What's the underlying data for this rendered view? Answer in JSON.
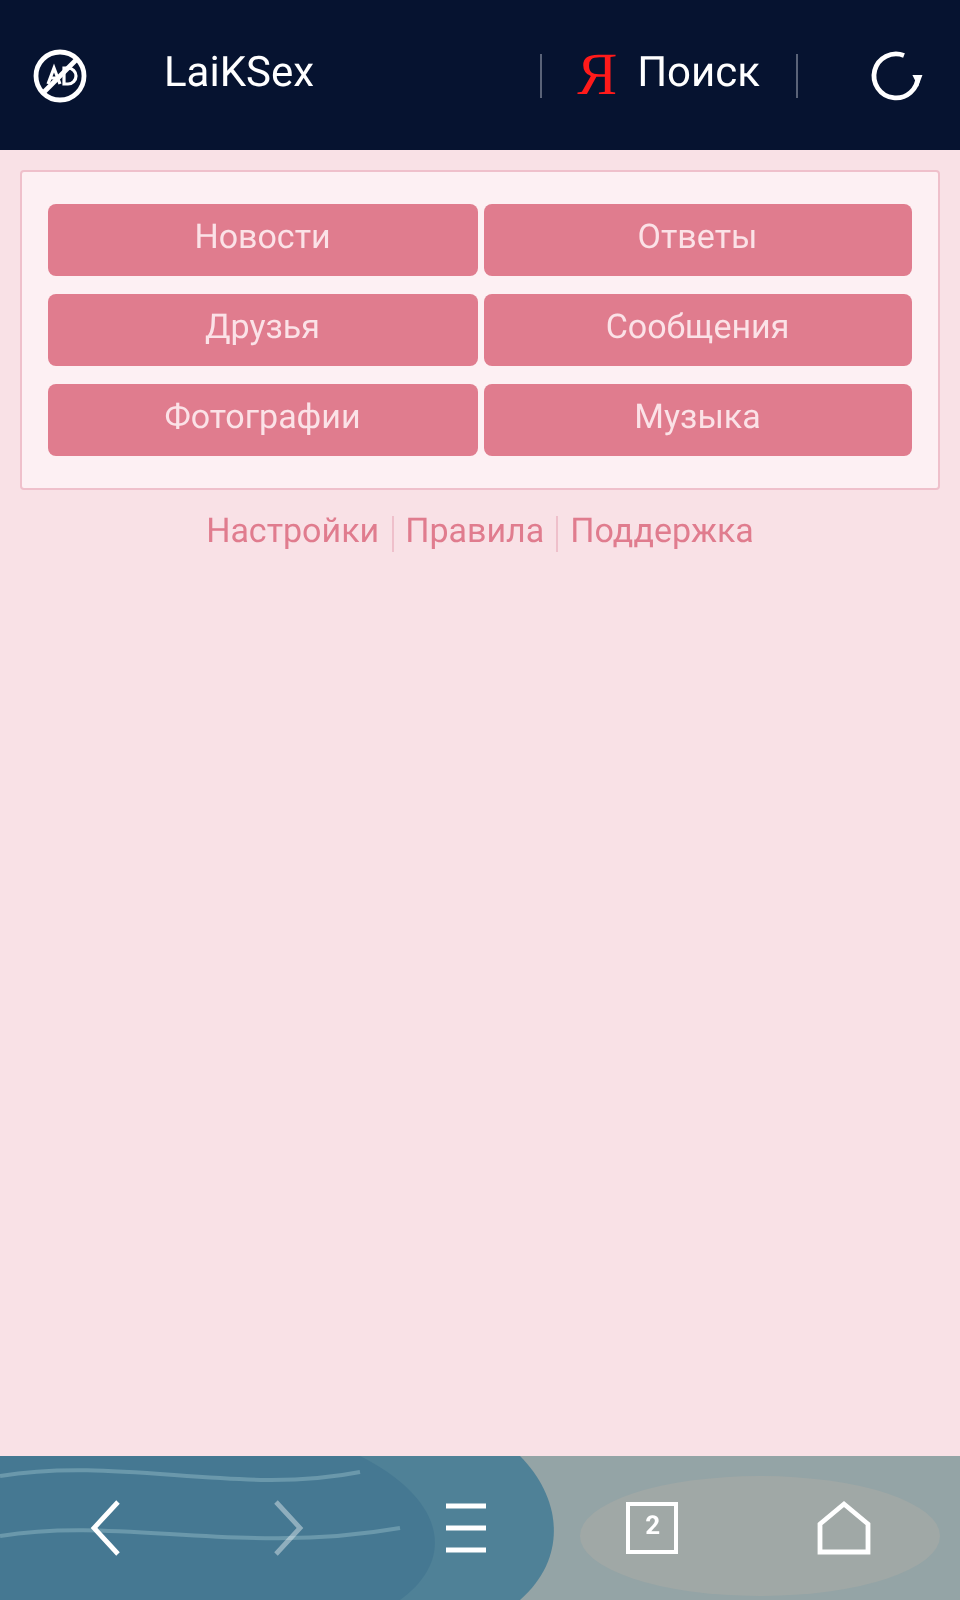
{
  "top_bar": {
    "site_title": "LaiKSex",
    "search_logo": "Я",
    "search_label": "Поиск"
  },
  "menu": {
    "buttons": [
      "Новости",
      "Ответы",
      "Друзья",
      "Сообщения",
      "Фотографии",
      "Музыка"
    ]
  },
  "footer_links": [
    "Настройки",
    "Правила",
    "Поддержка"
  ],
  "bottom_bar": {
    "back": {
      "disabled": false
    },
    "forward": {
      "disabled": true
    },
    "tab_count": "2"
  }
}
